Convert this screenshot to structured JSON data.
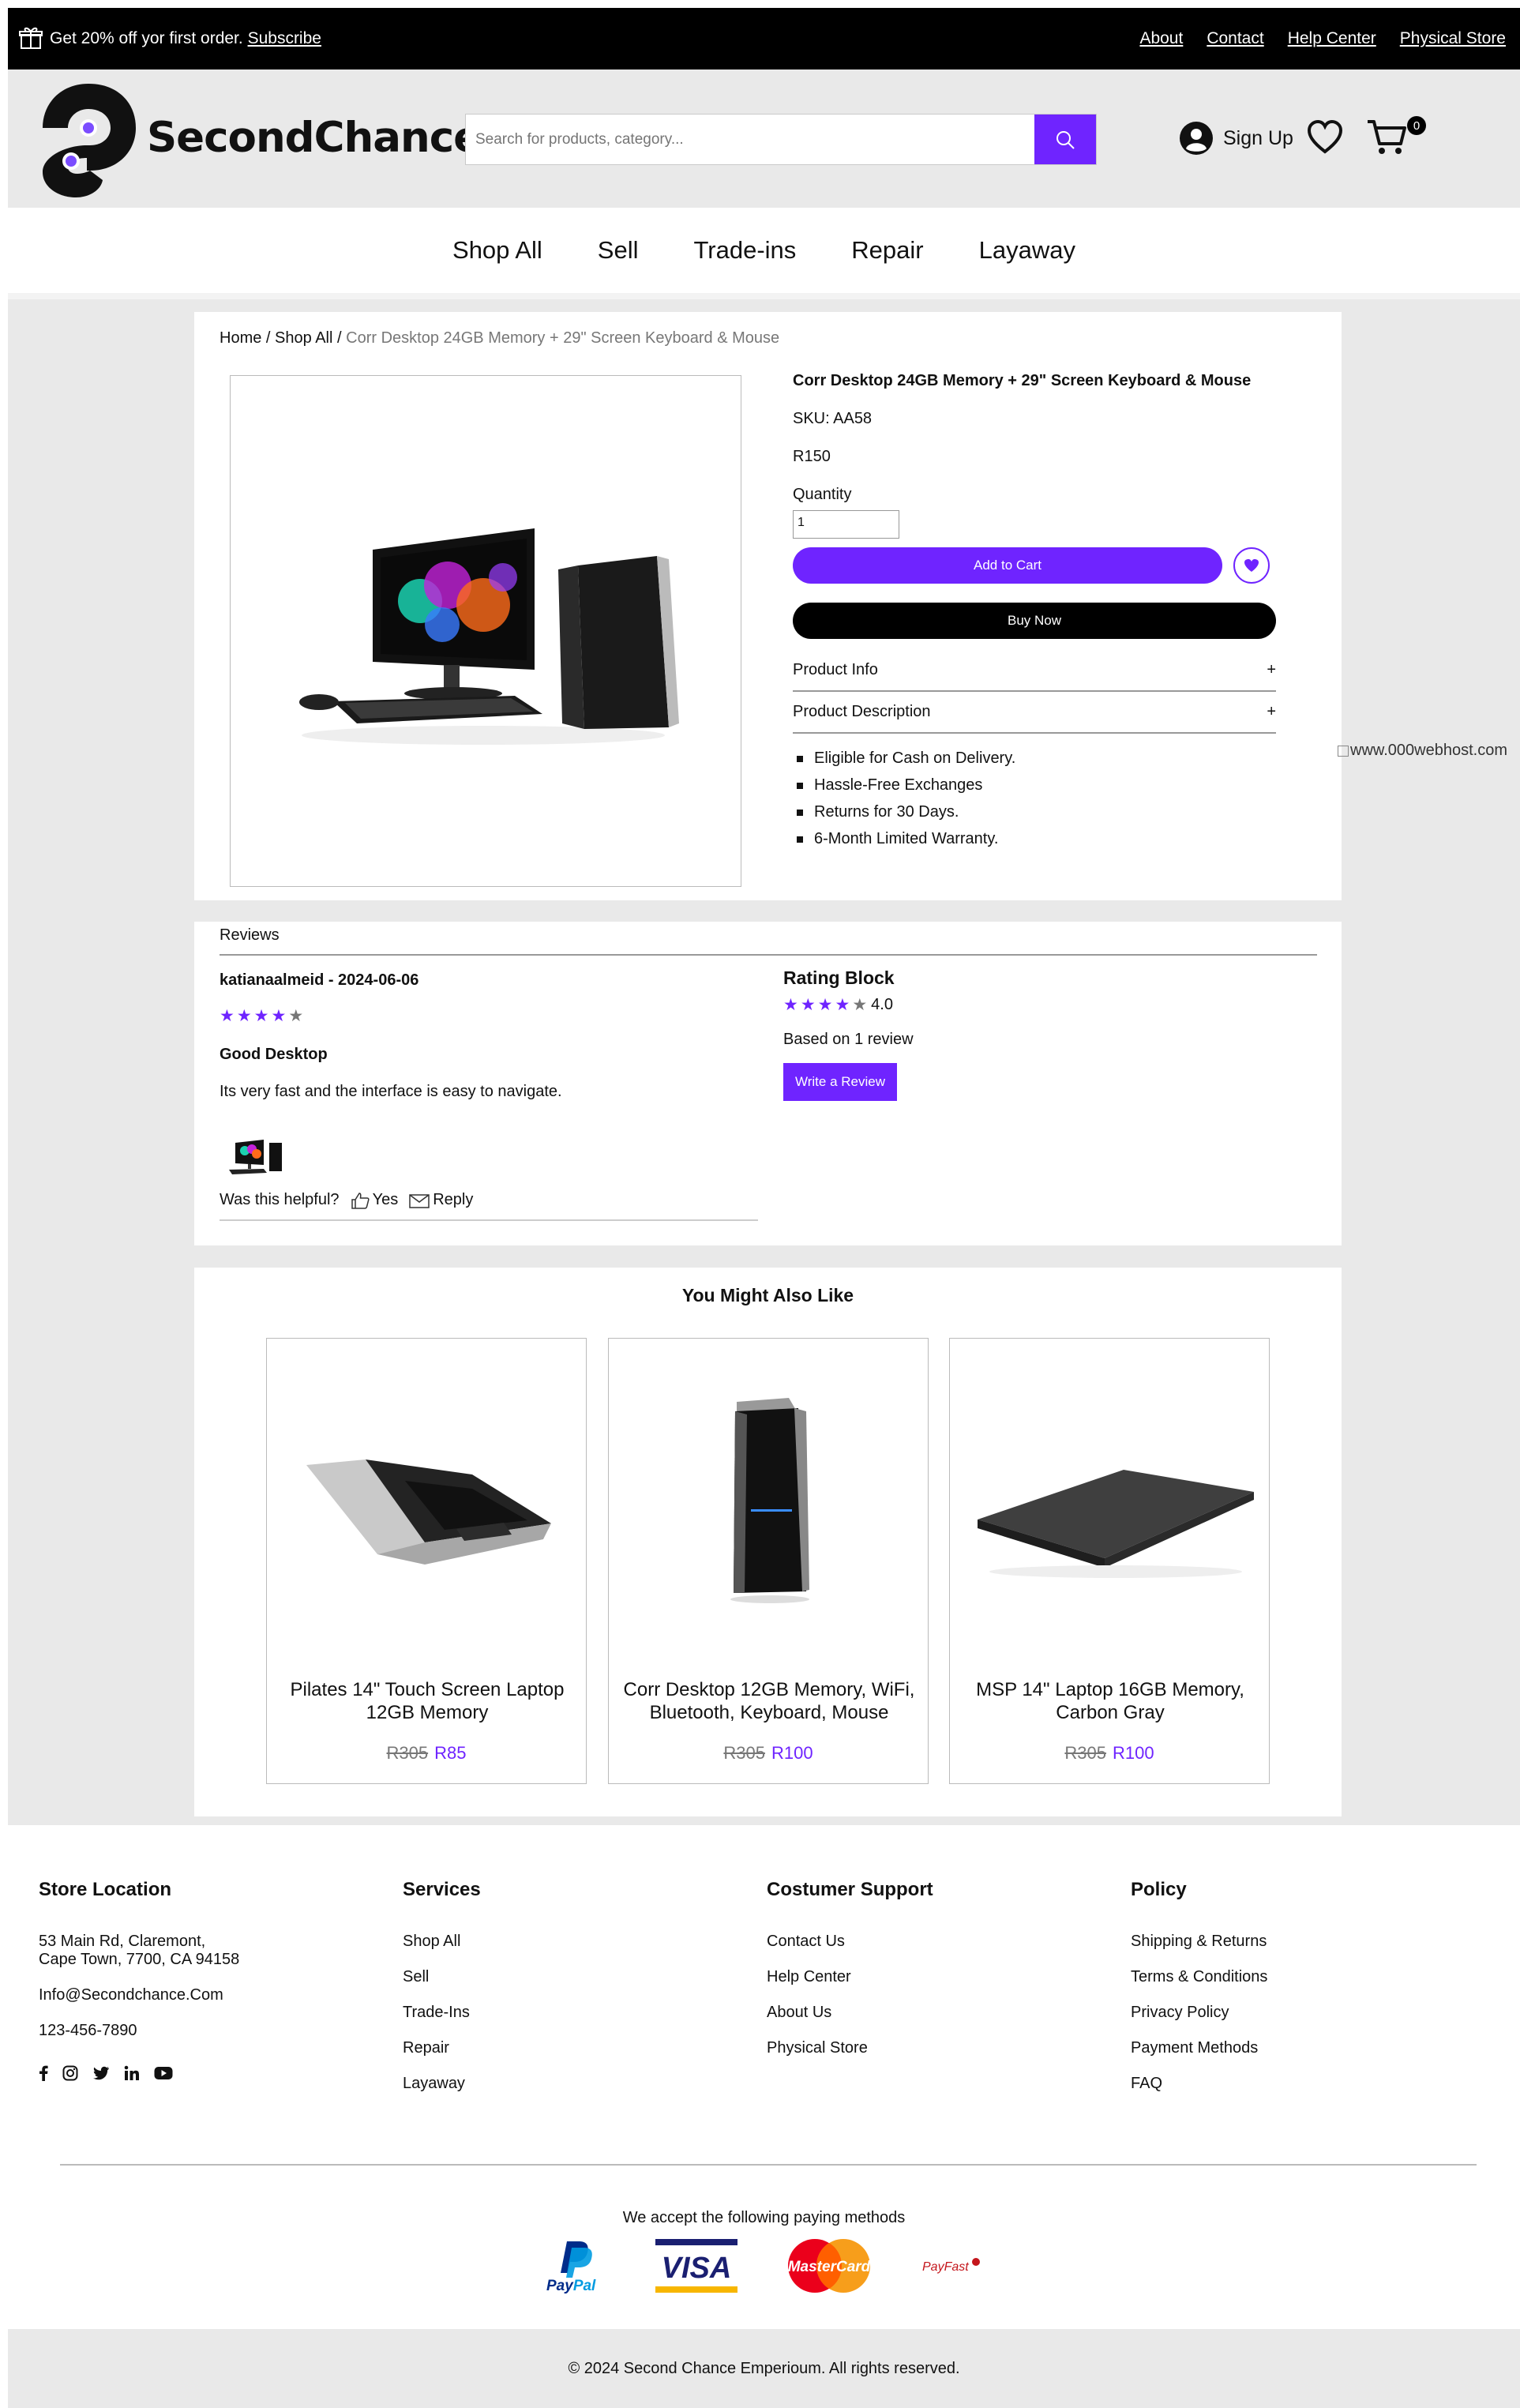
{
  "promo": {
    "text": "Get 20% off yor first order.",
    "subscribe": "Subscribe",
    "links": [
      "About",
      "Contact",
      "Help Center",
      "Physical Store"
    ]
  },
  "header": {
    "brand": "SecondChance",
    "search_placeholder": "Search for products, category...",
    "signup": "Sign Up",
    "cart_count": "0"
  },
  "nav": [
    "Shop All",
    "Sell",
    "Trade-ins",
    "Repair",
    "Layaway"
  ],
  "breadcrumb": {
    "home": "Home",
    "shop": "Shop All",
    "sep": "/",
    "current": "Corr Desktop 24GB Memory + 29\" Screen Keyboard & Mouse"
  },
  "product": {
    "title": "Corr Desktop 24GB Memory + 29\" Screen Keyboard & Mouse",
    "sku": "SKU: AA58",
    "price": "R150",
    "quantity_label": "Quantity",
    "quantity_value": "1",
    "add_to_cart": "Add to Cart",
    "buy_now": "Buy Now",
    "accordions": [
      {
        "label": "Product Info",
        "sign": "+"
      },
      {
        "label": "Product Description",
        "sign": "+"
      }
    ],
    "bullets": [
      "Eligible for Cash on Delivery.",
      "Hassle-Free Exchanges",
      "Returns for 30 Days.",
      "6-Month Limited Warranty."
    ]
  },
  "side_ad_text": "www.000webhost.com",
  "reviews": {
    "heading": "Reviews",
    "review": {
      "user_date": "katianaalmeid - 2024-06-06",
      "rating": 4,
      "title": "Good Desktop",
      "text": "Its very fast and the interface is easy to navigate.",
      "helpful": "Was this helpful?",
      "yes": "Yes",
      "reply": "Reply"
    },
    "rating_block": {
      "title": "Rating Block",
      "score": "4.0",
      "rating": 4,
      "based_on": "Based on 1 review",
      "write": "Write a Review"
    }
  },
  "related": {
    "title": "You Might Also Like",
    "items": [
      {
        "name": "Pilates 14\" Touch Screen Laptop 12GB Memory",
        "old_price": "R305",
        "new_price": "R85",
        "image": "laptop-silver"
      },
      {
        "name": "Corr Desktop 12GB Memory, WiFi, Bluetooth, Keyboard, Mouse",
        "old_price": "R305",
        "new_price": "R100",
        "image": "desktop-tower"
      },
      {
        "name": "MSP 14\" Laptop 16GB Memory, Carbon Gray",
        "old_price": "R305",
        "new_price": "R100",
        "image": "laptop-closed"
      }
    ]
  },
  "footer": {
    "store": {
      "title": "Store Location",
      "address_line1": "53 Main Rd, Claremont,",
      "address_line2": "Cape Town, 7700, CA 94158",
      "email": "Info@Secondchance.Com",
      "phone": "123-456-7890"
    },
    "services": {
      "title": "Services",
      "items": [
        "Shop All",
        "Sell",
        "Trade-Ins",
        "Repair",
        "Layaway"
      ]
    },
    "support": {
      "title": "Costumer Support",
      "items": [
        "Contact Us",
        "Help Center",
        "About Us",
        "Physical Store"
      ]
    },
    "policy": {
      "title": "Policy",
      "items": [
        "Shipping & Returns",
        "Terms & Conditions",
        "Privacy Policy",
        "Payment Methods",
        "FAQ"
      ]
    },
    "social": [
      "facebook-icon",
      "instagram-icon",
      "twitter-icon",
      "linkedin-icon",
      "youtube-icon"
    ],
    "pay_heading": "We accept the following paying methods",
    "pay_logos": {
      "paypal_1": "Pay",
      "paypal_2": "Pal",
      "visa": "VISA",
      "mastercard": "MasterCard",
      "payfast": "PayFast"
    },
    "copyright": "© 2024 Second Chance Emperioum. All rights reserved."
  },
  "colors": {
    "accent": "#6f24ff",
    "band": "#e9e9e9"
  }
}
